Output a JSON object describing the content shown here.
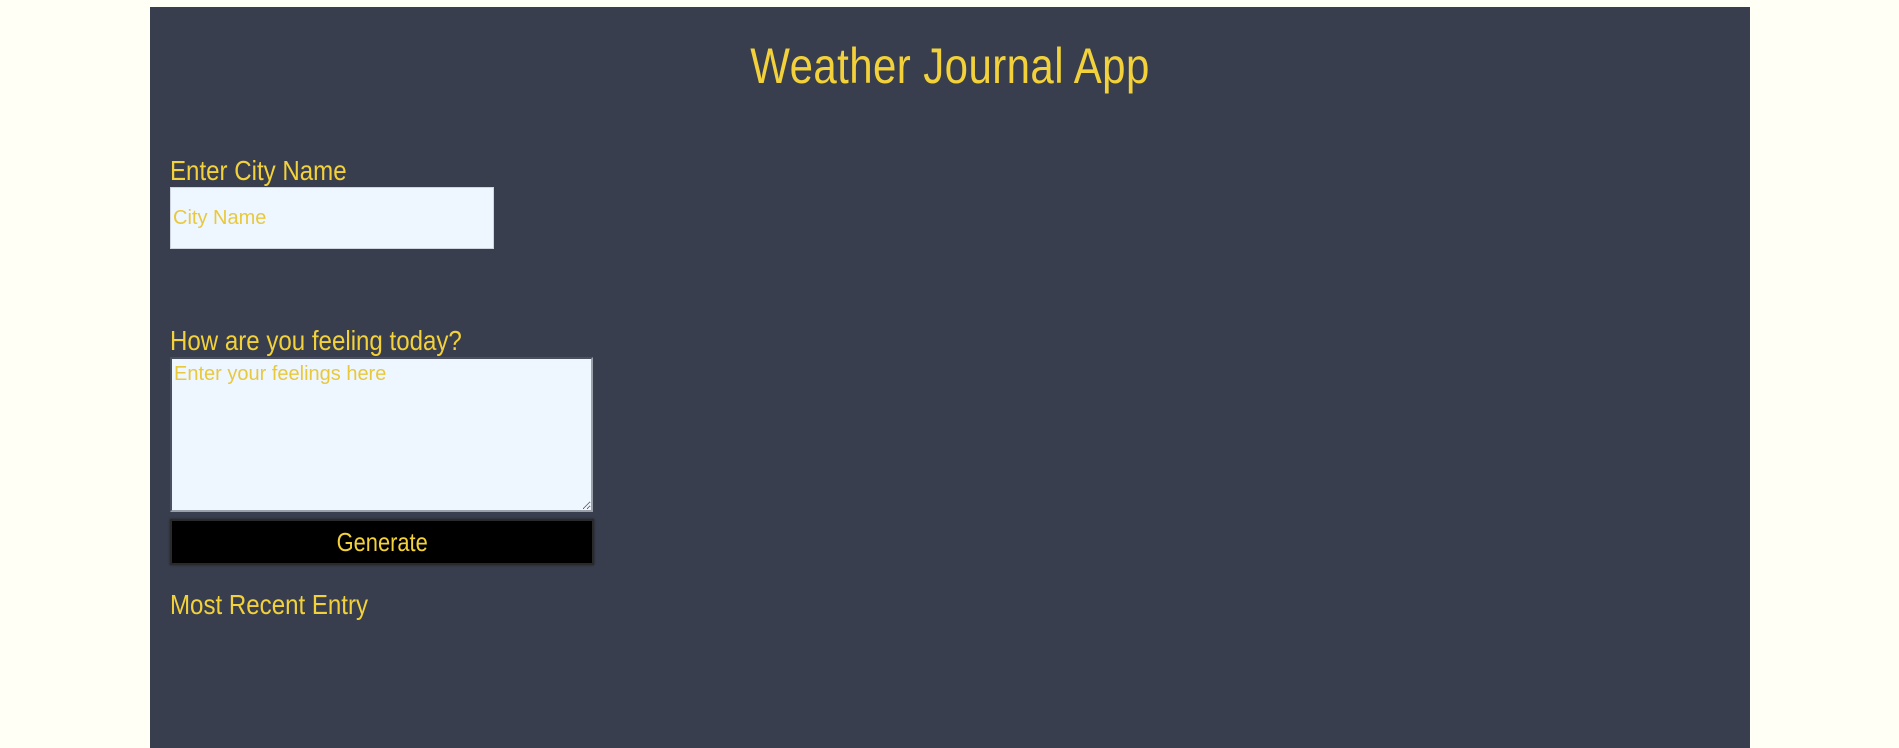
{
  "app": {
    "title": "Weather Journal App"
  },
  "city": {
    "label": "Enter City Name",
    "placeholder": "City Name",
    "value": ""
  },
  "feelings": {
    "label": "How are you feeling today?",
    "placeholder": "Enter your feelings here",
    "value": ""
  },
  "generate": {
    "label": "Generate"
  },
  "recent": {
    "label": "Most Recent Entry"
  },
  "colors": {
    "page_background": "#fffff6",
    "panel_background": "#383e4d",
    "accent_text": "#f2d13a",
    "input_background": "#eef6ff",
    "button_background": "#000000"
  }
}
